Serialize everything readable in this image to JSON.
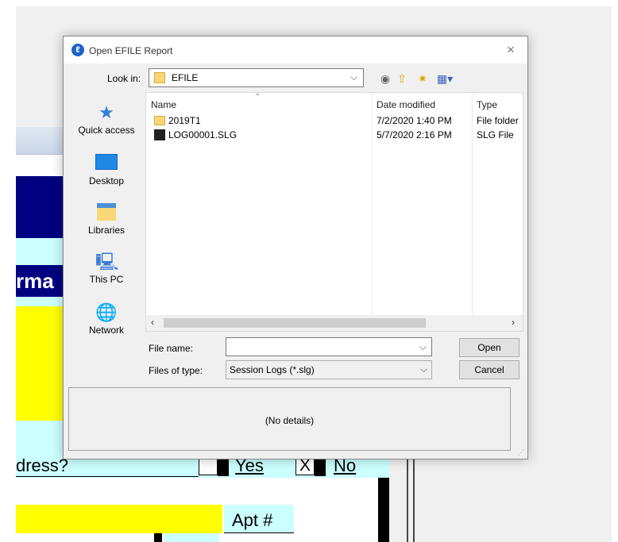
{
  "background": {
    "section_fragment": "rma",
    "question_fragment": "dress?",
    "option_yes": "Yes",
    "option_no": "No",
    "checked_mark": "X",
    "apt_label": "Apt #"
  },
  "dialog": {
    "title": "Open EFILE Report",
    "close_icon": "×",
    "look_in": {
      "label": "Look in:",
      "value": "EFILE"
    },
    "toolbar_icons": [
      "back-icon",
      "up-folder-icon",
      "new-folder-icon",
      "view-menu-icon"
    ],
    "places": [
      {
        "label": "Quick access",
        "icon": "star-icon"
      },
      {
        "label": "Desktop",
        "icon": "desktop-icon"
      },
      {
        "label": "Libraries",
        "icon": "libraries-icon"
      },
      {
        "label": "This PC",
        "icon": "computer-icon"
      },
      {
        "label": "Network",
        "icon": "network-icon"
      }
    ],
    "columns": {
      "name": "Name",
      "date": "Date modified",
      "type": "Type"
    },
    "files": [
      {
        "name": "2019T1",
        "date": "7/2/2020 1:40 PM",
        "type": "File folder",
        "icon": "folder-icon"
      },
      {
        "name": "LOG00001.SLG",
        "date": "5/7/2020 2:16 PM",
        "type": "SLG File",
        "icon": "slg-file-icon"
      }
    ],
    "file_name": {
      "label": "File name:",
      "value": ""
    },
    "files_of_type": {
      "label": "Files of type:",
      "value": "Session Logs (*.slg)"
    },
    "buttons": {
      "open": "Open",
      "cancel": "Cancel"
    },
    "details": "(No details)"
  }
}
